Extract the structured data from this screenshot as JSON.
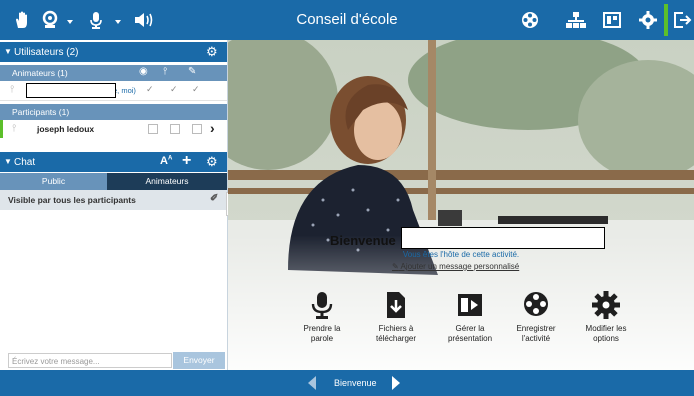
{
  "app": {
    "title": "Conseil d'école"
  },
  "users": {
    "header": "Utilisateurs (2)",
    "animateurs_label": "Animateurs (1)",
    "moderator_suffix": "e, moi)",
    "participants_label": "Participants (1)",
    "participant_name": "joseph ledoux"
  },
  "chat": {
    "header": "Chat",
    "font_label": "A",
    "tabs": [
      "Public",
      "Animateurs"
    ],
    "visible_text": "Visible par tous les participants",
    "input_placeholder": "Écrivez votre message...",
    "send_label": "Envoyer"
  },
  "welcome": {
    "title": "Bienvenue",
    "host_text": "Vous êtes l'hôte de cette activité.",
    "add_message": "Ajouter un message personnalisé"
  },
  "actions": [
    {
      "label": "Prendre la parole",
      "icon": "microphone-icon"
    },
    {
      "label": "Fichiers à télécharger",
      "icon": "download-file-icon"
    },
    {
      "label": "Gérer la présentation",
      "icon": "presentation-icon"
    },
    {
      "label": "Enregistrer l'activité",
      "icon": "film-reel-icon"
    },
    {
      "label": "Modifier les options",
      "icon": "gear-icon"
    }
  ],
  "footer": {
    "label": "Bienvenue"
  },
  "colors": {
    "primary": "#1a6aa8",
    "secondary": "#6893ba",
    "accent_green": "#5cbf2a"
  }
}
